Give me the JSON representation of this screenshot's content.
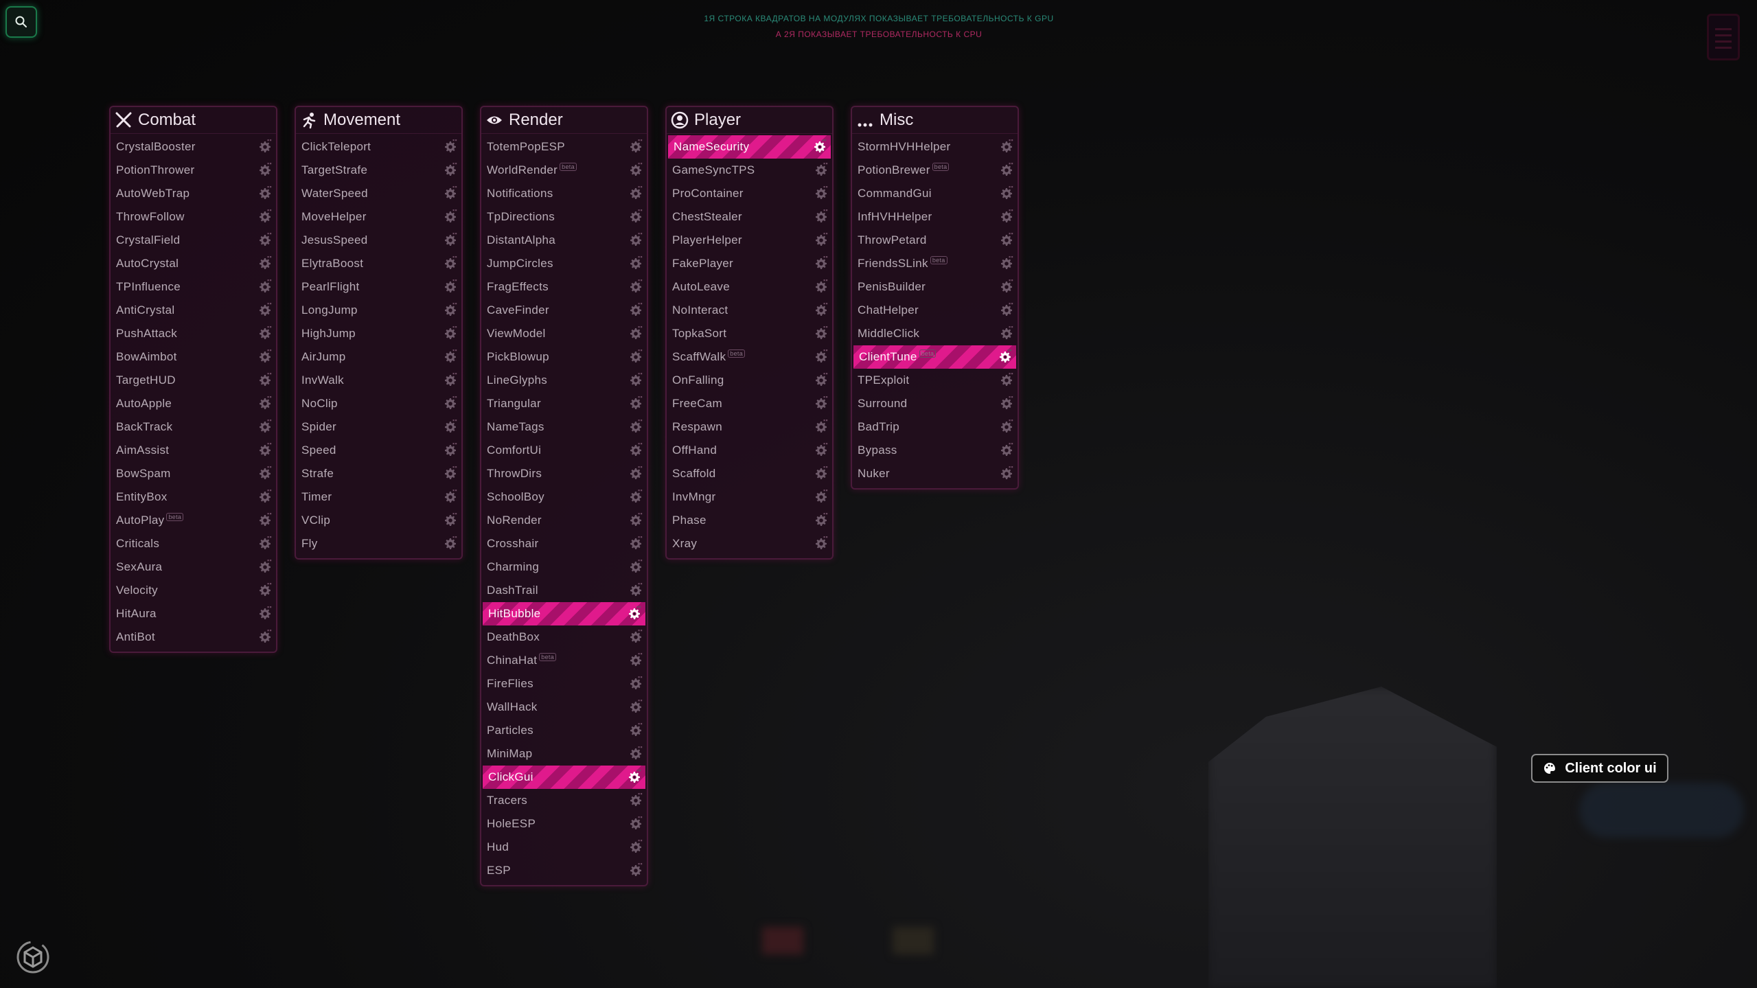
{
  "notes": {
    "line1": "1Я СТРОКА КВАДРАТОВ НА МОДУЛЯХ ПОКАЗЫВАЕТ ТРЕБОВАТЕЛЬНОСТЬ К GPU",
    "line2": "А 2Я ПОКАЗЫВАЕТ ТРЕБОВАТЕЛЬНОСТЬ К CPU"
  },
  "colors": {
    "accent": "#e01a8c",
    "panel_bg": "#240e1e",
    "text": "#b8acb6"
  },
  "panels": [
    {
      "title": "Combat",
      "icon": "swords-icon",
      "items": [
        {
          "label": "CrystalBooster"
        },
        {
          "label": "PotionThrower"
        },
        {
          "label": "AutoWebTrap"
        },
        {
          "label": "ThrowFollow"
        },
        {
          "label": "CrystalField"
        },
        {
          "label": "AutoCrystal"
        },
        {
          "label": "TPInfluence"
        },
        {
          "label": "AntiCrystal"
        },
        {
          "label": "PushAttack"
        },
        {
          "label": "BowAimbot"
        },
        {
          "label": "TargetHUD"
        },
        {
          "label": "AutoApple"
        },
        {
          "label": "BackTrack"
        },
        {
          "label": "AimAssist"
        },
        {
          "label": "BowSpam"
        },
        {
          "label": "EntityBox"
        },
        {
          "label": "AutoPlay",
          "beta": "beta"
        },
        {
          "label": "Criticals"
        },
        {
          "label": "SexAura"
        },
        {
          "label": "Velocity"
        },
        {
          "label": "HitAura"
        },
        {
          "label": "AntiBot"
        }
      ]
    },
    {
      "title": "Movement",
      "icon": "running-icon",
      "items": [
        {
          "label": "ClickTeleport"
        },
        {
          "label": "TargetStrafe"
        },
        {
          "label": "WaterSpeed"
        },
        {
          "label": "MoveHelper"
        },
        {
          "label": "JesusSpeed"
        },
        {
          "label": "ElytraBoost"
        },
        {
          "label": "PearlFlight"
        },
        {
          "label": "LongJump"
        },
        {
          "label": "HighJump"
        },
        {
          "label": "AirJump"
        },
        {
          "label": "InvWalk"
        },
        {
          "label": "NoClip"
        },
        {
          "label": "Spider"
        },
        {
          "label": "Speed"
        },
        {
          "label": "Strafe"
        },
        {
          "label": "Timer"
        },
        {
          "label": "VClip"
        },
        {
          "label": "Fly"
        }
      ]
    },
    {
      "title": "Render",
      "icon": "eye-icon",
      "items": [
        {
          "label": "TotemPopESP"
        },
        {
          "label": "WorldRender",
          "beta": "beta"
        },
        {
          "label": "Notifications"
        },
        {
          "label": "TpDirections"
        },
        {
          "label": "DistantAlpha"
        },
        {
          "label": "JumpCircles"
        },
        {
          "label": "FragEffects"
        },
        {
          "label": "CaveFinder"
        },
        {
          "label": "ViewModel"
        },
        {
          "label": "PickBlowup"
        },
        {
          "label": "LineGlyphs"
        },
        {
          "label": "Triangular"
        },
        {
          "label": "NameTags"
        },
        {
          "label": "ComfortUi"
        },
        {
          "label": "ThrowDirs"
        },
        {
          "label": "SchoolBoy"
        },
        {
          "label": "NoRender"
        },
        {
          "label": "Crosshair"
        },
        {
          "label": "Charming"
        },
        {
          "label": "DashTrail"
        },
        {
          "label": "HitBubble",
          "active": true
        },
        {
          "label": "DeathBox"
        },
        {
          "label": "ChinaHat",
          "beta": "beta"
        },
        {
          "label": "FireFlies"
        },
        {
          "label": "WallHack"
        },
        {
          "label": "Particles"
        },
        {
          "label": "MiniMap"
        },
        {
          "label": "ClickGui",
          "active": true
        },
        {
          "label": "Tracers"
        },
        {
          "label": "HoleESP"
        },
        {
          "label": "Hud"
        },
        {
          "label": "ESP"
        }
      ]
    },
    {
      "title": "Player",
      "icon": "user-icon",
      "items": [
        {
          "label": "NameSecurity",
          "active": true
        },
        {
          "label": "GameSyncTPS"
        },
        {
          "label": "ProContainer"
        },
        {
          "label": "ChestStealer"
        },
        {
          "label": "PlayerHelper"
        },
        {
          "label": "FakePlayer"
        },
        {
          "label": "AutoLeave"
        },
        {
          "label": "NoInteract"
        },
        {
          "label": "TopkaSort"
        },
        {
          "label": "ScaffWalk",
          "beta": "beta"
        },
        {
          "label": "OnFalling"
        },
        {
          "label": "FreeCam"
        },
        {
          "label": "Respawn"
        },
        {
          "label": "OffHand"
        },
        {
          "label": "Scaffold"
        },
        {
          "label": "InvMngr"
        },
        {
          "label": "Phase"
        },
        {
          "label": "Xray"
        }
      ]
    },
    {
      "title": "Misc",
      "icon": "more-icon",
      "items": [
        {
          "label": "StormHVHHelper"
        },
        {
          "label": "PotionBrewer",
          "beta": "beta"
        },
        {
          "label": "CommandGui"
        },
        {
          "label": "InfHVHHelper"
        },
        {
          "label": "ThrowPetard"
        },
        {
          "label": "FriendsSLink",
          "beta": "beta"
        },
        {
          "label": "PenisBuilder"
        },
        {
          "label": "ChatHelper"
        },
        {
          "label": "MiddleClick"
        },
        {
          "label": "ClientTune",
          "beta": "beta",
          "active": true
        },
        {
          "label": "TPExploit"
        },
        {
          "label": "Surround"
        },
        {
          "label": "BadTrip"
        },
        {
          "label": "Bypass"
        },
        {
          "label": "Nuker"
        }
      ]
    }
  ],
  "client_color_button": {
    "label": "Client color ui",
    "icon": "palette-icon"
  }
}
